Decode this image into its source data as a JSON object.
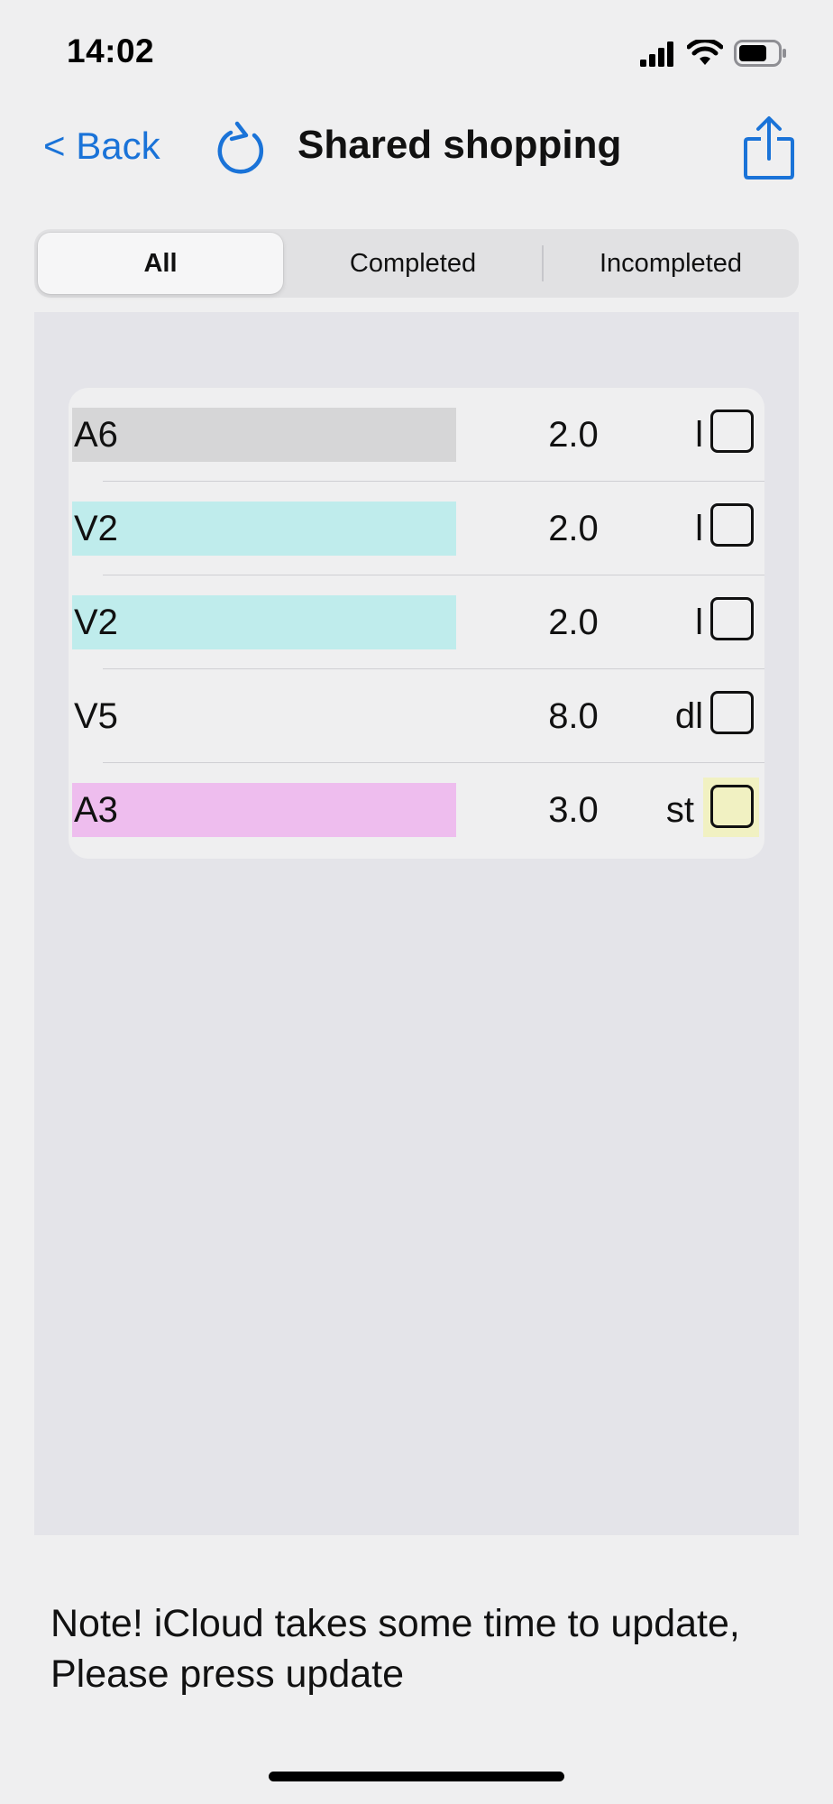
{
  "status_bar": {
    "time": "14:02",
    "icons": [
      "cellular-signal-icon",
      "wifi-icon",
      "battery-icon"
    ]
  },
  "nav": {
    "back_label": "< Back",
    "refresh_icon": "refresh-icon",
    "title": "Shared shopping",
    "share_icon": "share-icon",
    "accent_color": "#1a73d8"
  },
  "segments": {
    "items": [
      "All",
      "Completed",
      "Incompleted"
    ],
    "selected": "All"
  },
  "list": {
    "items": [
      {
        "name": "A6",
        "quantity": "2.0",
        "unit": "l",
        "checked": false,
        "name_color": "#d6d6d7"
      },
      {
        "name": "V2",
        "quantity": "2.0",
        "unit": "l",
        "checked": false,
        "name_color": "#bfecec"
      },
      {
        "name": "V2",
        "quantity": "2.0",
        "unit": "l",
        "checked": false,
        "name_color": "#bfecec"
      },
      {
        "name": "V5",
        "quantity": "8.0",
        "unit": "dl",
        "checked": false,
        "name_color": ""
      },
      {
        "name": "A3",
        "quantity": "3.0",
        "unit": "st",
        "checked": false,
        "name_color": "#eebdee",
        "checkbox_color": "#f1f1c2"
      }
    ]
  },
  "note": {
    "line1": "Note! iCloud takes some time to update,",
    "line2": "Please press update"
  }
}
